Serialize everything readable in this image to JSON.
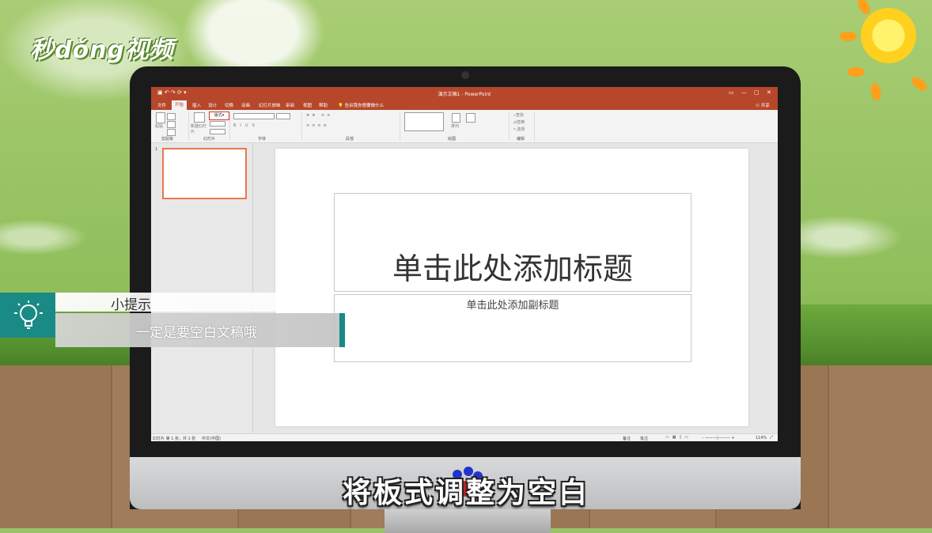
{
  "branding": {
    "logo_text": "秒dǒng视频"
  },
  "powerpoint": {
    "window_title": "演示文稿1 - PowerPoint",
    "tabs": [
      "文件",
      "开始",
      "插入",
      "设计",
      "切换",
      "动画",
      "幻灯片放映",
      "审阅",
      "视图",
      "帮助"
    ],
    "tell_me": "告诉我你想要做什么",
    "share": "共享",
    "ribbon": {
      "paste": "粘贴",
      "new_slide": "新建幻灯片",
      "layout_button": "版式",
      "groups": {
        "clipboard": "剪贴板",
        "slides": "幻灯片",
        "font": "字体",
        "paragraph": "段落",
        "drawing": "绘图",
        "editing": "编辑"
      },
      "editing_items": [
        "查找",
        "替换",
        "选择"
      ],
      "arrange": "排列"
    },
    "thumbnail_number": "1",
    "slide": {
      "title_placeholder": "单击此处添加标题",
      "subtitle_placeholder": "单击此处添加副标题"
    },
    "status": {
      "slide_info": "幻灯片 第 1 张，共 1 张",
      "language": "中文(中国)",
      "notes": "备注",
      "comments": "批注",
      "zoom": "114%"
    }
  },
  "tip": {
    "title": "小提示",
    "body": "一定是要空白文稿哦"
  },
  "subtitle": "将板式调整为空白"
}
